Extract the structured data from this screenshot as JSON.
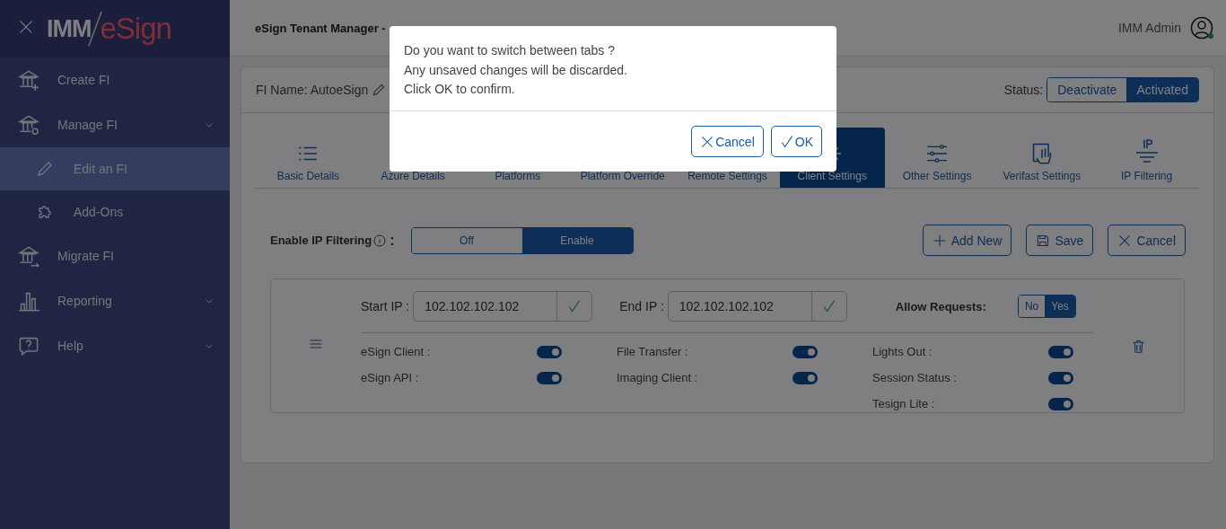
{
  "sidebar": {
    "logo": {
      "left": "IMM",
      "right": "eSign"
    },
    "items": [
      {
        "label": "Create FI",
        "has_menu": false,
        "selected": false
      },
      {
        "label": "Manage FI",
        "has_menu": true,
        "selected": false,
        "children": [
          {
            "label": "Edit an FI",
            "selected": true
          },
          {
            "label": "Add-Ons",
            "selected": false
          }
        ]
      },
      {
        "label": "Migrate FI",
        "has_menu": false,
        "selected": false
      },
      {
        "label": "Reporting",
        "has_menu": true,
        "selected": false
      },
      {
        "label": "Help",
        "has_menu": true,
        "selected": false
      }
    ]
  },
  "header": {
    "title": "eSign Tenant Manager -",
    "user": "IMM Admin",
    "online": true
  },
  "fi": {
    "name": "FI Name: AutoeSign",
    "status_label": "Status:",
    "status_options": [
      {
        "label": "Deactivate",
        "selected": false
      },
      {
        "label": "Activated",
        "selected": true
      }
    ]
  },
  "tabs": [
    {
      "label": "Basic Details",
      "selected": false
    },
    {
      "label": "Azure Details",
      "selected": false
    },
    {
      "label": "Platforms",
      "selected": false
    },
    {
      "label": "Platform Override",
      "selected": false
    },
    {
      "label": "Remote Settings",
      "selected": false
    },
    {
      "label": "Client Settings",
      "selected": true
    },
    {
      "label": "Other Settings",
      "selected": false
    },
    {
      "label": "Verifast Settings",
      "selected": false
    },
    {
      "label": "IP Filtering",
      "selected": false
    }
  ],
  "ip_filtering": {
    "label": "Enable IP Filtering",
    "colon": ":",
    "options": [
      {
        "label": "Off",
        "selected": false
      },
      {
        "label": "Enable",
        "selected": true
      }
    ],
    "actions": [
      "Add New",
      "Save",
      "Cancel"
    ]
  },
  "rule": {
    "start_label": "Start IP :",
    "start_value": "102.102.102.102",
    "end_label": "End IP :",
    "end_value": "102.102.102.102",
    "allow_label": "Allow Requests:",
    "allow_options": [
      {
        "label": "No",
        "selected": false
      },
      {
        "label": "Yes",
        "selected": true
      }
    ],
    "service_columns": [
      [
        {
          "label": "eSign Client :",
          "on": true
        },
        {
          "label": "eSign API :",
          "on": true
        }
      ],
      [
        {
          "label": "File Transfer :",
          "on": true
        },
        {
          "label": "Imaging Client :",
          "on": true
        }
      ],
      [
        {
          "label": "Lights Out :",
          "on": true
        },
        {
          "label": "Session Status :",
          "on": true
        },
        {
          "label": "Tesign Lite :",
          "on": true
        }
      ]
    ]
  },
  "dialog": {
    "lines": [
      "Do you want to switch between tabs ?",
      "Any unsaved changes will be discarded.",
      "Click OK to confirm."
    ],
    "buttons": [
      "Cancel",
      "OK"
    ]
  }
}
